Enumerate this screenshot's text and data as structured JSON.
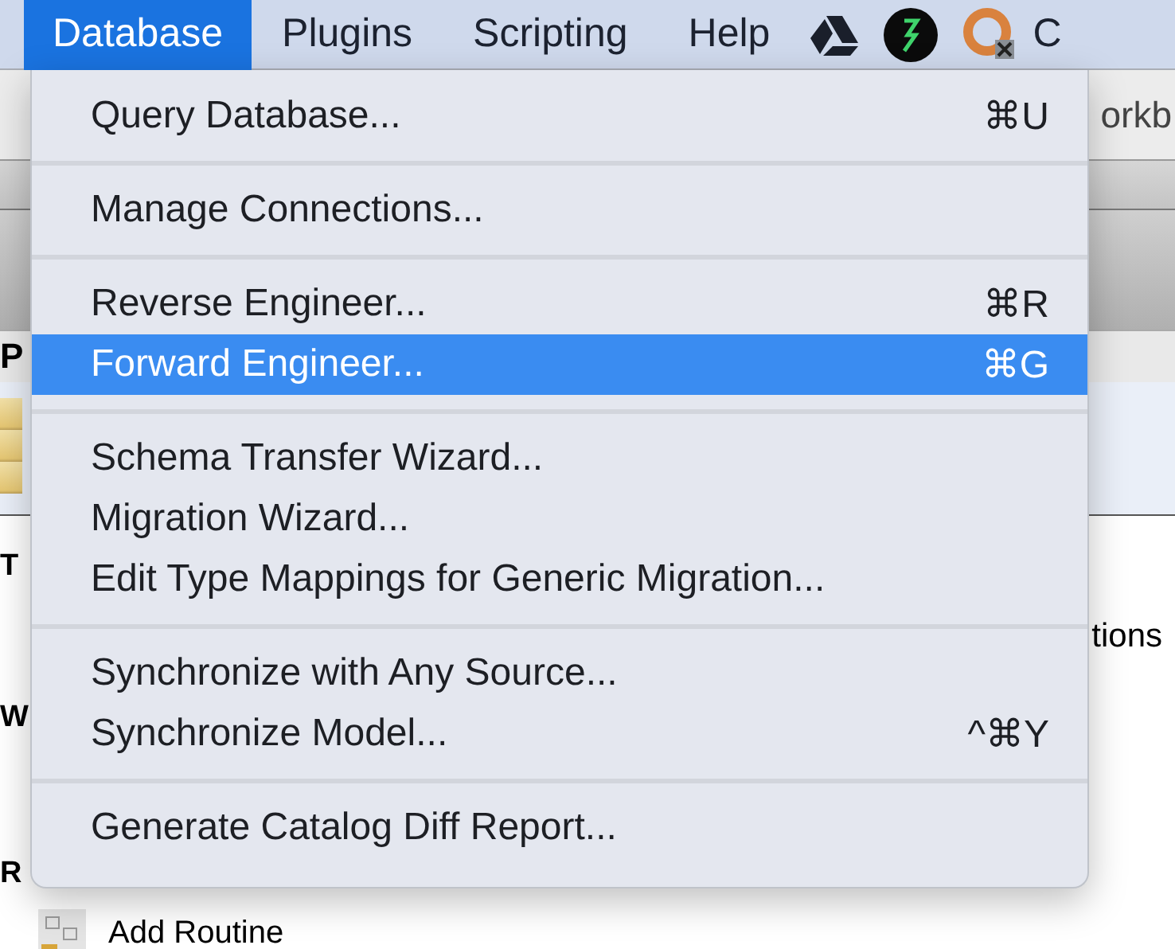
{
  "menu_bar": {
    "items": [
      {
        "label": "Database",
        "selected": true
      },
      {
        "label": "Plugins",
        "selected": false
      },
      {
        "label": "Scripting",
        "selected": false
      },
      {
        "label": "Help",
        "selected": false
      }
    ],
    "extra": "C"
  },
  "background_window": {
    "title": "orkb",
    "header": "P",
    "labels": [
      "T",
      "W",
      "R"
    ],
    "right_text": "tions",
    "routine_button": "Add Routine"
  },
  "menu": {
    "groups": [
      {
        "items": [
          {
            "label": "Query Database...",
            "shortcut": "⌘U",
            "selected": false
          }
        ]
      },
      {
        "items": [
          {
            "label": "Manage Connections...",
            "selected": false
          }
        ]
      },
      {
        "items": [
          {
            "label": "Reverse Engineer...",
            "shortcut": "⌘R",
            "selected": false
          },
          {
            "label": "Forward Engineer...",
            "shortcut": "⌘G",
            "selected": true
          }
        ]
      },
      {
        "items": [
          {
            "label": "Schema Transfer Wizard...",
            "selected": false
          },
          {
            "label": "Migration Wizard...",
            "selected": false
          },
          {
            "label": "Edit Type Mappings for Generic Migration...",
            "selected": false
          }
        ]
      },
      {
        "items": [
          {
            "label": "Synchronize with Any Source...",
            "selected": false
          },
          {
            "label": "Synchronize Model...",
            "shortcut": "^⌘Y",
            "selected": false
          }
        ]
      },
      {
        "items": [
          {
            "label": "Generate Catalog Diff Report...",
            "selected": false
          }
        ]
      }
    ]
  }
}
